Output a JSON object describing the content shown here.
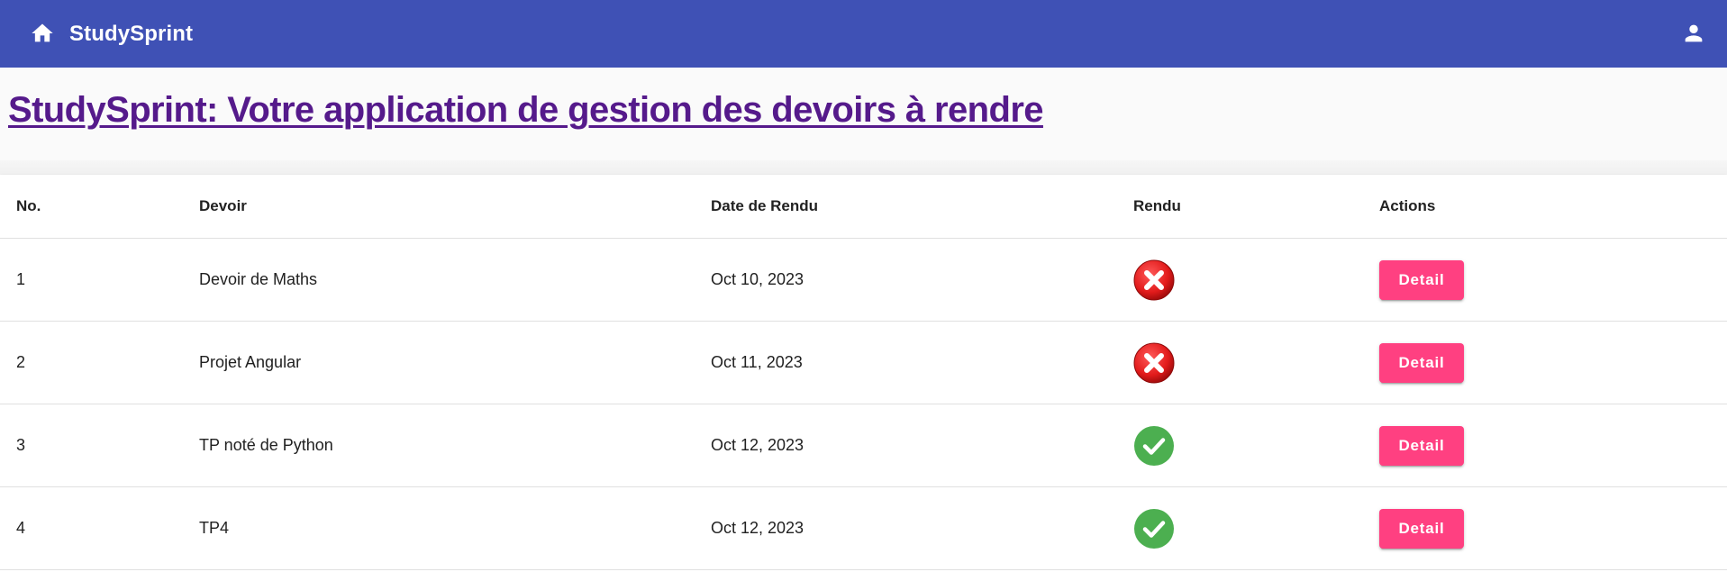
{
  "toolbar": {
    "app_title": "StudySprint",
    "home_icon": "home-icon",
    "account_icon": "account-icon",
    "background": "#3f51b5"
  },
  "page": {
    "heading": "StudySprint: Votre application de gestion des devoirs à rendre",
    "heading_color": "#551a8b"
  },
  "table": {
    "columns": {
      "no": "No.",
      "devoir": "Devoir",
      "date": "Date de Rendu",
      "rendu": "Rendu",
      "actions": "Actions"
    },
    "rows": [
      {
        "no": "1",
        "devoir": "Devoir de Maths",
        "date": "Oct 10, 2023",
        "rendu": false,
        "rendu_icon": "cross-icon",
        "action_label": "Detail"
      },
      {
        "no": "2",
        "devoir": "Projet Angular",
        "date": "Oct 11, 2023",
        "rendu": false,
        "rendu_icon": "cross-icon",
        "action_label": "Detail"
      },
      {
        "no": "3",
        "devoir": "TP noté de Python",
        "date": "Oct 12, 2023",
        "rendu": true,
        "rendu_icon": "check-icon",
        "action_label": "Detail"
      },
      {
        "no": "4",
        "devoir": "TP4",
        "date": "Oct 12, 2023",
        "rendu": true,
        "rendu_icon": "check-icon",
        "action_label": "Detail"
      }
    ]
  },
  "colors": {
    "accent_button": "#ff4081",
    "status_not_done": "#e21b1b",
    "status_done": "#4caf50"
  }
}
